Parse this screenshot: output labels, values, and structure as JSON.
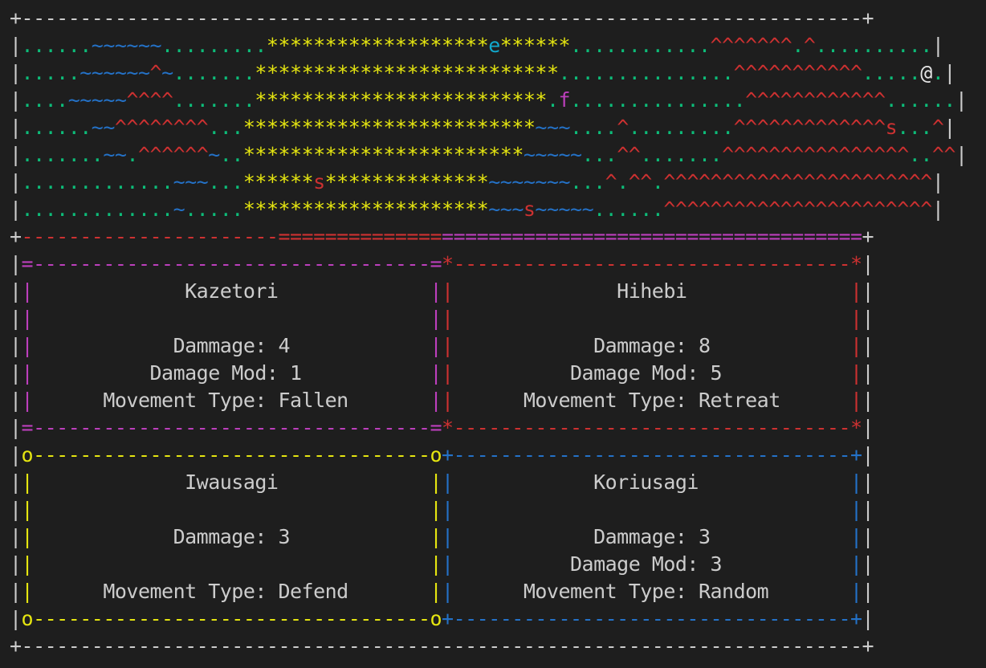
{
  "map": {
    "rows": [
      {
        "row": 0,
        "segments": [
          [
            "ground",
            "......"
          ],
          [
            "water",
            "~~~~~~"
          ],
          [
            "ground",
            "........."
          ],
          [
            "stars",
            "*******************"
          ],
          [
            "exit",
            "e"
          ],
          [
            "stars",
            "******"
          ],
          [
            "ground",
            "............"
          ],
          [
            "mountain",
            "^^^^^^^"
          ],
          [
            "ground",
            "."
          ],
          [
            "mountain",
            "^"
          ],
          [
            "ground",
            ".........."
          ]
        ]
      },
      {
        "row": 1,
        "segments": [
          [
            "ground",
            "....."
          ],
          [
            "water",
            "~~~~~~"
          ],
          [
            "mountain",
            "^"
          ],
          [
            "water",
            "~"
          ],
          [
            "ground",
            "......."
          ],
          [
            "stars",
            "**************************"
          ],
          [
            "ground",
            "..............."
          ],
          [
            "mountain",
            "^^^^^^^^^^^"
          ],
          [
            "ground",
            "....."
          ],
          [
            "player",
            "@"
          ],
          [
            "ground",
            "."
          ]
        ]
      },
      {
        "row": 2,
        "segments": [
          [
            "ground",
            "...."
          ],
          [
            "water",
            "~~~~~"
          ],
          [
            "mountain",
            "^^^^"
          ],
          [
            "ground",
            "......."
          ],
          [
            "stars",
            "*************************"
          ],
          [
            "ground",
            "."
          ],
          [
            "food",
            "f"
          ],
          [
            "ground",
            "..............."
          ],
          [
            "mountain",
            "^^^^^^^^^^^^"
          ],
          [
            "ground",
            "......"
          ]
        ]
      },
      {
        "row": 3,
        "segments": [
          [
            "ground",
            "......"
          ],
          [
            "water",
            "~~"
          ],
          [
            "mountain",
            "^^^^^^^^"
          ],
          [
            "ground",
            "..."
          ],
          [
            "stars",
            "*************************"
          ],
          [
            "water",
            "~~~"
          ],
          [
            "ground",
            "...."
          ],
          [
            "mountain",
            "^"
          ],
          [
            "ground",
            "........."
          ],
          [
            "mountain",
            "^^^^^^^^^^^^^"
          ],
          [
            "enemy",
            "s"
          ],
          [
            "ground",
            "..."
          ],
          [
            "mountain",
            "^"
          ]
        ]
      },
      {
        "row": 4,
        "segments": [
          [
            "ground",
            "......."
          ],
          [
            "water",
            "~~"
          ],
          [
            "ground",
            "."
          ],
          [
            "mountain",
            "^^^^^^"
          ],
          [
            "water",
            "~"
          ],
          [
            "ground",
            ".."
          ],
          [
            "stars",
            "************************"
          ],
          [
            "water",
            "~~~~~"
          ],
          [
            "ground",
            "..."
          ],
          [
            "mountain",
            "^^"
          ],
          [
            "ground",
            "......."
          ],
          [
            "mountain",
            "^^^^^^^^^^^^^^^^"
          ],
          [
            "ground",
            ".."
          ],
          [
            "mountain",
            "^^"
          ]
        ]
      },
      {
        "row": 5,
        "segments": [
          [
            "ground",
            "............."
          ],
          [
            "water",
            "~~~"
          ],
          [
            "ground",
            "..."
          ],
          [
            "stars",
            "******"
          ],
          [
            "enemy",
            "s"
          ],
          [
            "stars",
            "**************"
          ],
          [
            "water",
            "~~~~~~~"
          ],
          [
            "ground",
            "..."
          ],
          [
            "mountain",
            "^"
          ],
          [
            "ground",
            "."
          ],
          [
            "mountain",
            "^^"
          ],
          [
            "ground",
            "."
          ],
          [
            "mountain",
            "^^^^^^^^^^^^^^^^^^^^^^^"
          ]
        ]
      },
      {
        "row": 6,
        "segments": [
          [
            "ground",
            "............."
          ],
          [
            "water",
            "~"
          ],
          [
            "ground",
            "....."
          ],
          [
            "stars",
            "*********************"
          ],
          [
            "water",
            "~~~"
          ],
          [
            "enemy",
            "s"
          ],
          [
            "water",
            "~~~~~"
          ],
          [
            "ground",
            "......"
          ],
          [
            "mountain",
            "^^^^^^^^^^^^^^^^^^^^^^^"
          ]
        ]
      }
    ]
  },
  "cards": [
    {
      "name": "Kazetori",
      "color": "#bc3fbc",
      "lines": [
        "Kazetori",
        "",
        "Dammage: 4",
        "Damage Mod: 1",
        "Movement Type: Fallen"
      ]
    },
    {
      "name": "Hihebi",
      "color": "#cd3131",
      "lines": [
        "Hihebi",
        "",
        "Dammage: 8",
        "Damage Mod: 5",
        "Movement Type: Retreat"
      ]
    },
    {
      "name": "Iwausagi",
      "color": "#e5e510",
      "lines": [
        "Iwausagi",
        "",
        "Dammage: 3",
        "",
        "Movement Type: Defend"
      ]
    },
    {
      "name": "Koriusagi",
      "color": "#2472c8",
      "lines": [
        "Koriusagi",
        "",
        "Dammage: 3",
        "Damage Mod: 3",
        "Movement Type: Random"
      ]
    }
  ],
  "palette": {
    "background": "#1e1e1e",
    "border": "#cccccc",
    "ground": "#0dbc79",
    "water": "#2472c8",
    "stars": "#e5e510",
    "mountain": "#cd3131",
    "exit": "#11a8cd",
    "food": "#bc3fbc",
    "player": "#e5e5e5",
    "text": "#cccccc"
  }
}
